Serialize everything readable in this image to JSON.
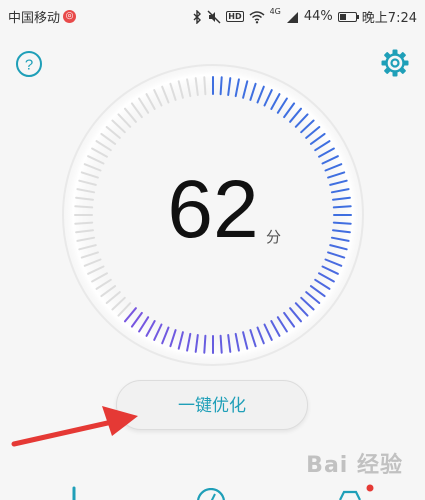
{
  "status_bar": {
    "carrier": "中国移动",
    "carrier_badge": "◎",
    "hd_label": "HD",
    "network_label": "4G",
    "battery_percent": 44,
    "battery_text": "44%",
    "time": "晚上7:24"
  },
  "header": {
    "help_symbol": "?"
  },
  "gauge": {
    "score": "62",
    "unit": "分",
    "fraction": 0.62,
    "colors": {
      "blue": "#3f6fe0",
      "purple": "#7a55e0",
      "inactive": "#dddddd"
    }
  },
  "action": {
    "optimize_label": "一键优化"
  },
  "watermark": {
    "text": "Bai 经验"
  },
  "colors": {
    "accent": "#1f9fb8",
    "arrow": "#e53935"
  }
}
